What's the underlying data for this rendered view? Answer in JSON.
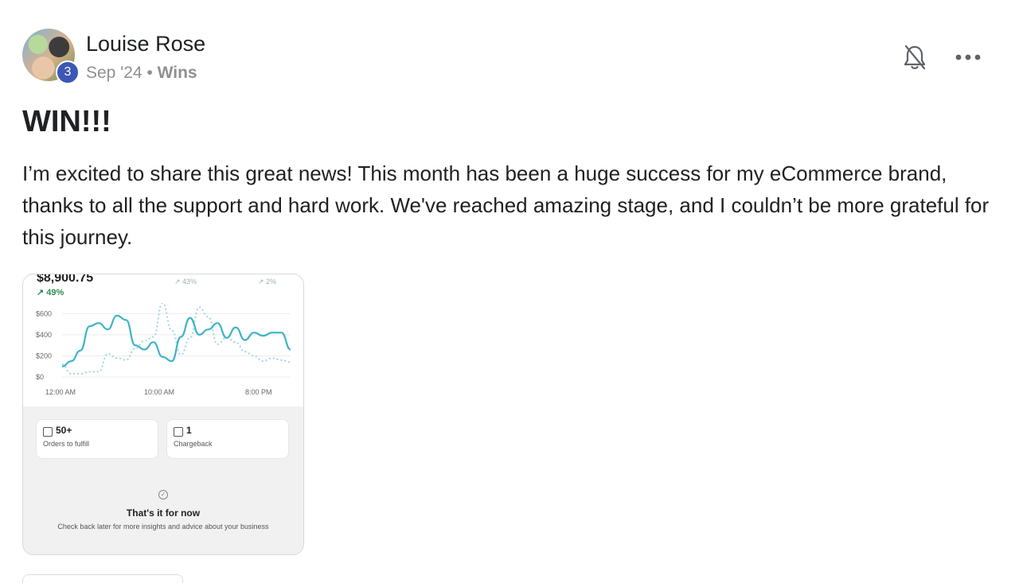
{
  "post": {
    "author": "Louise Rose",
    "level": "3",
    "date": "Sep '24",
    "separator": "•",
    "category": "Wins",
    "title": "WIN!!!",
    "body": "I’m excited to share this great news! This month has been a huge success for my eCommerce brand, thanks to all the support and hard work. We've reached amazing stage, and I couldn’t be more grateful for this journey."
  },
  "header_icons": {
    "bell": "bell-off-icon",
    "more": "more-horizontal-icon"
  },
  "attachment": {
    "total_sales": "$8,900.75",
    "growth": "↗ 49%",
    "stat_a": "↗ 43%",
    "stat_b": "↗ 2%",
    "cards": [
      {
        "value": "50+",
        "label": "Orders to fulfill",
        "icon": "inbox-icon"
      },
      {
        "value": "1",
        "label": "Chargeback",
        "icon": "clipboard-icon"
      }
    ],
    "done_title": "That's it for now",
    "done_desc": "Check back later for more insights and advice about your business",
    "colors": {
      "primary_line": "#3fb3c9",
      "comparison_line": "#9fd6dd",
      "growth": "#2e8b57"
    }
  },
  "chart_data": {
    "type": "line",
    "y_ticks": [
      "$600",
      "$400",
      "$200",
      "$0"
    ],
    "ylim": [
      0,
      700
    ],
    "x_ticks": [
      "12:00 AM",
      "10:00 AM",
      "8:00 PM"
    ],
    "series": [
      {
        "values": [
          100,
          150,
          250,
          480,
          510,
          450,
          580,
          540,
          300,
          260,
          330,
          190,
          150,
          380,
          560,
          400,
          450,
          510,
          370,
          470,
          350,
          420,
          390,
          420,
          420,
          260
        ]
      },
      {
        "values": [
          120,
          30,
          30,
          50,
          50,
          220,
          180,
          160,
          270,
          340,
          380,
          700,
          440,
          210,
          370,
          660,
          570,
          310,
          370,
          330,
          240,
          200,
          150,
          180,
          160,
          140
        ]
      }
    ]
  }
}
